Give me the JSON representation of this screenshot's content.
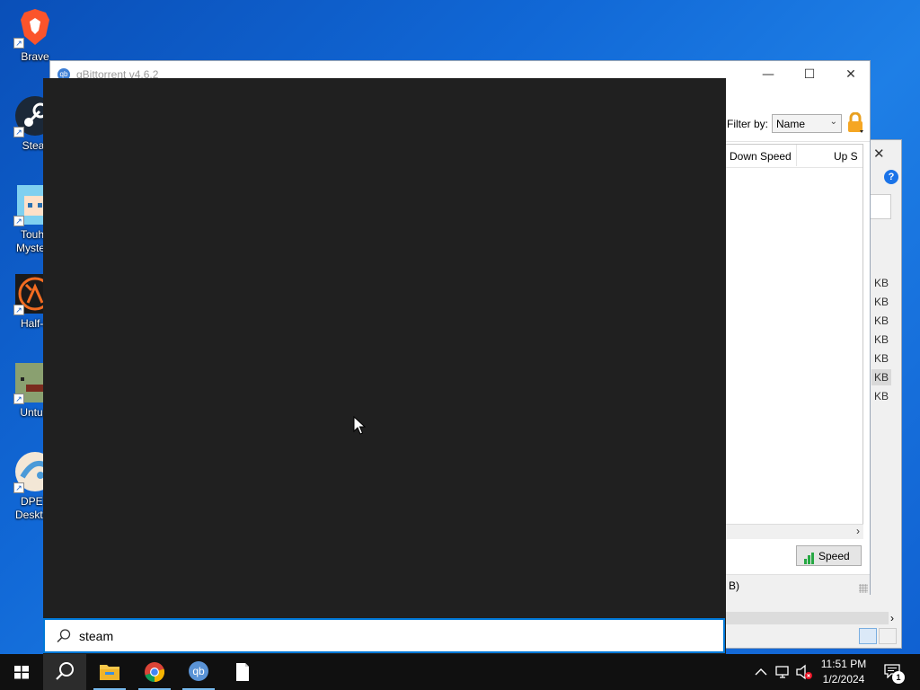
{
  "desktop": {
    "icons": [
      {
        "name": "brave",
        "label": "Brave"
      },
      {
        "name": "steam",
        "label": "Stear"
      },
      {
        "name": "touhou",
        "label": "Touhc\nMystery"
      },
      {
        "name": "half-life",
        "label": "Half-L"
      },
      {
        "name": "unturned",
        "label": "Unturr"
      },
      {
        "name": "dpet",
        "label": "DPET\nDesktop"
      }
    ]
  },
  "qbittorrent": {
    "title": "qBittorrent v4.6.2",
    "filter_label": "Filter by:",
    "filter_value": "Name",
    "columns": [
      "Down Speed",
      "Up S"
    ],
    "speed_button": "Speed",
    "status_text": "B)",
    "controls": {
      "minimize": "—",
      "maximize": "☐",
      "close": "✕"
    }
  },
  "secondary_window": {
    "close": "✕",
    "help": "?",
    "kb_labels": [
      "KB",
      "KB",
      "KB",
      "KB",
      "KB",
      "KB",
      "KB"
    ],
    "selected_kb_index": 5
  },
  "search": {
    "query": "steam"
  },
  "taskbar": {
    "apps": [
      "start",
      "search",
      "file-explorer",
      "chrome",
      "qbittorrent",
      "notepad"
    ],
    "active_app": "search",
    "clock": {
      "time": "11:51 PM",
      "date": "1/2/2024"
    },
    "notification_count": "1"
  },
  "colors": {
    "accent": "#0078d7",
    "panel_bg": "#202020",
    "taskbar_bg": "#101010",
    "desktop_bg": "#1168d6"
  }
}
